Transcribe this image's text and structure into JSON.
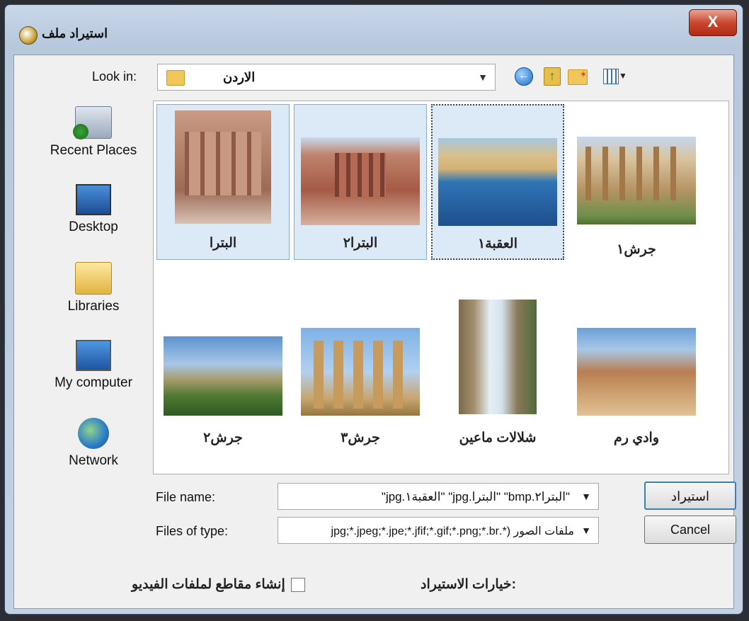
{
  "window": {
    "title": "استيراد ملف",
    "close_symbol": "X"
  },
  "toolbar": {
    "look_in_label": "Look in:",
    "look_in_value": "الاردن",
    "back_icon": "back-arrow-icon",
    "up_icon": "up-folder-icon",
    "new_folder_icon": "new-folder-icon",
    "view_icon": "view-menu-icon"
  },
  "places": [
    {
      "label": "Recent Places",
      "icon": "recent-places-icon"
    },
    {
      "label": "Desktop",
      "icon": "desktop-icon"
    },
    {
      "label": "Libraries",
      "icon": "libraries-icon"
    },
    {
      "label": "My computer",
      "icon": "computer-icon"
    },
    {
      "label": "Network",
      "icon": "network-icon"
    }
  ],
  "files": [
    {
      "name": "البترا",
      "state": "selected"
    },
    {
      "name": "البترا٢",
      "state": "selected"
    },
    {
      "name": "العقبة١",
      "state": "focused"
    },
    {
      "name": "جرش١",
      "state": "normal"
    },
    {
      "name": "جرش٢",
      "state": "normal"
    },
    {
      "name": "جرش٣",
      "state": "normal"
    },
    {
      "name": "شلالات ماعين",
      "state": "normal"
    },
    {
      "name": "وادي رم",
      "state": "normal"
    }
  ],
  "form": {
    "file_name_label": "File name:",
    "file_name_value": "\"البترا٢.bmp\" \"البترا.jpg\" \"العقبة١.jpg\"",
    "file_type_label": "Files of type:",
    "file_type_value": "ملفات الصور (*.jpg;*.jpeg;*.jpe;*.jfif;*.gif;*.png;*.br",
    "import_button": "استيراد",
    "cancel_button": "Cancel"
  },
  "options": {
    "label": "خيارات الاستيراد:",
    "create_video_clips": "إنشاء مقاطع لملفات الفيديو",
    "create_video_clips_checked": false
  }
}
